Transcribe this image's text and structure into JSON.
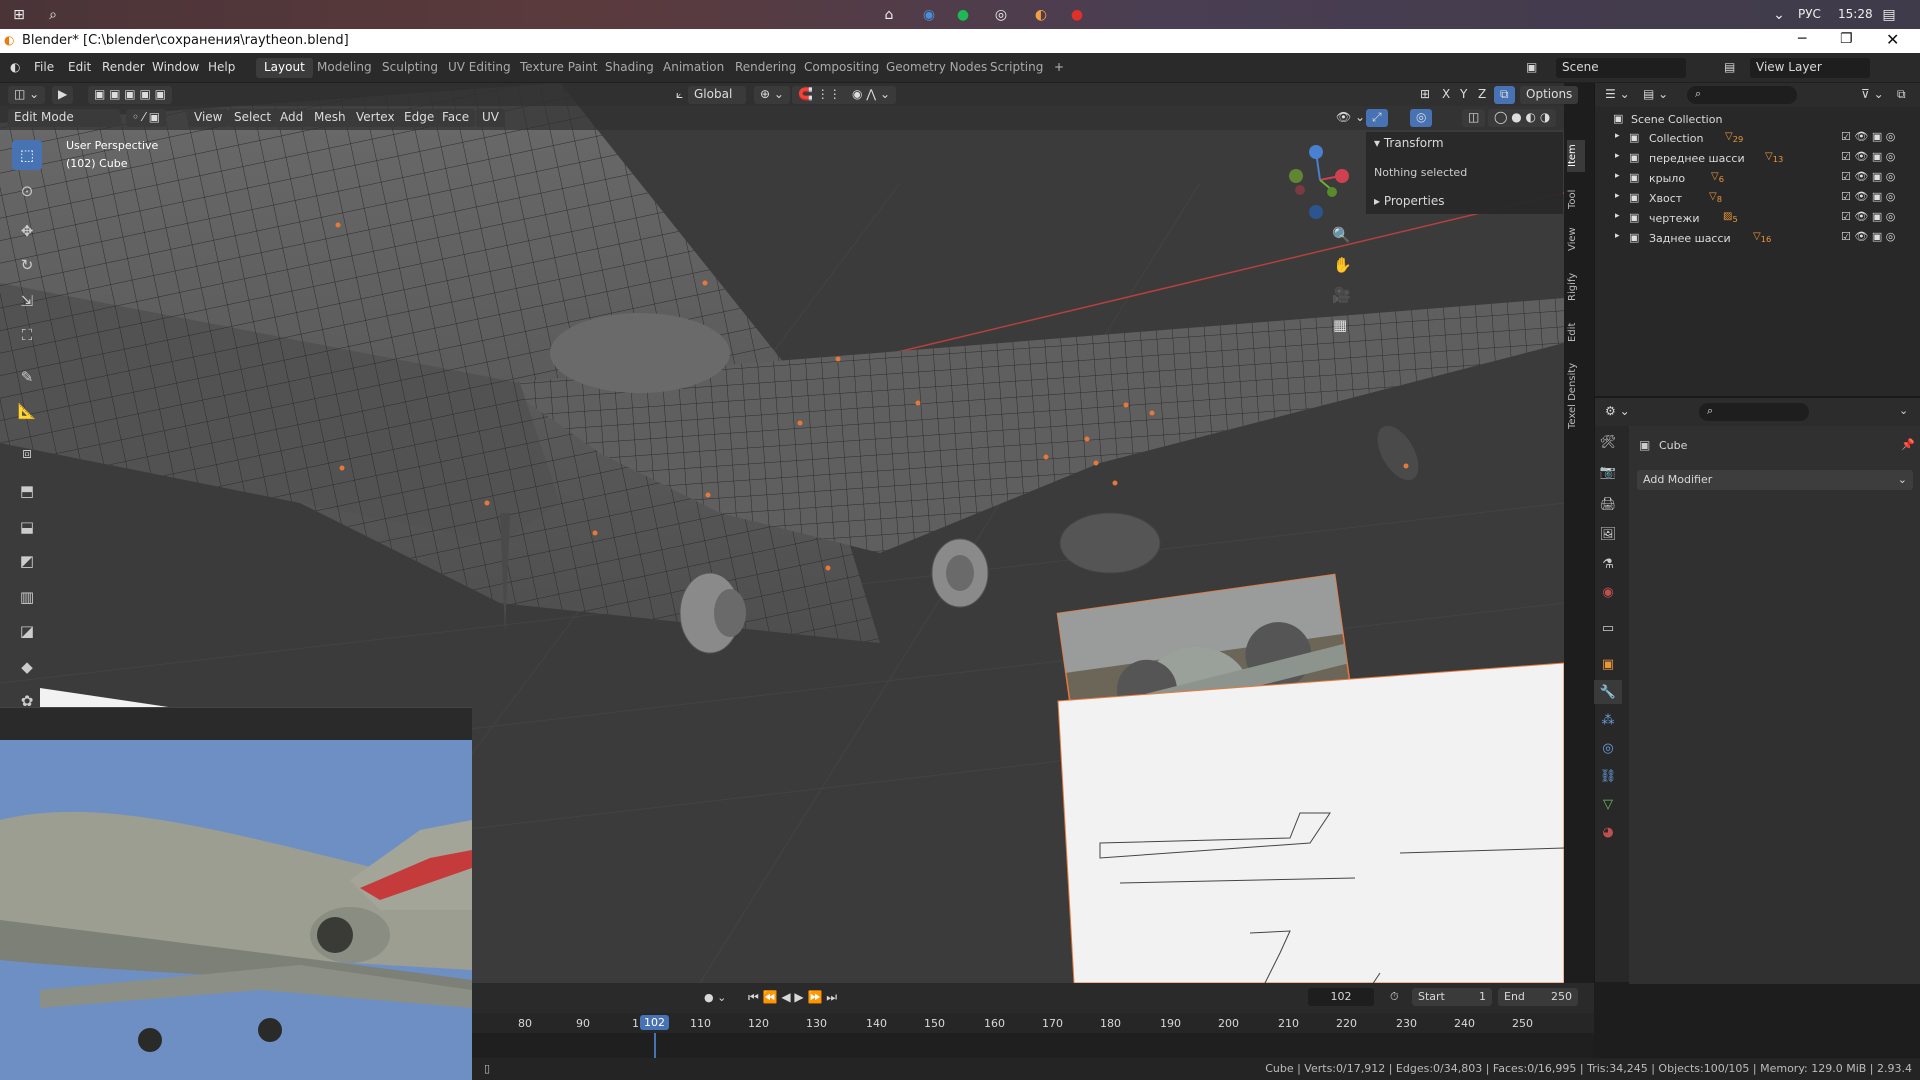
{
  "taskbar": {
    "lang": "РУС",
    "time": "15:28"
  },
  "window": {
    "title": "Blender* [C:\\blender\\сохранения\\raytheon.blend]"
  },
  "menu": {
    "items": [
      "File",
      "Edit",
      "Render",
      "Window",
      "Help"
    ]
  },
  "workspaces": [
    "Layout",
    "Modeling",
    "Sculpting",
    "UV Editing",
    "Texture Paint",
    "Shading",
    "Animation",
    "Rendering",
    "Compositing",
    "Geometry Nodes",
    "Scripting"
  ],
  "active_workspace": "Layout",
  "scene": {
    "label": "Scene",
    "view_layer": "View Layer"
  },
  "viewport": {
    "mode": "Edit Mode",
    "menus": [
      "View",
      "Select",
      "Add",
      "Mesh",
      "Vertex",
      "Edge",
      "Face",
      "UV"
    ],
    "orientation": "Global",
    "options_label": "Options",
    "axes": [
      "X",
      "Y",
      "Z"
    ],
    "perspective": "User Perspective",
    "object": "(102) Cube",
    "npanel": {
      "transform": "Transform",
      "nothing_selected": "Nothing selected",
      "properties": "Properties",
      "tabs": [
        "Item",
        "Tool",
        "View",
        "Rigify",
        "Edit",
        "Texel Density"
      ]
    }
  },
  "outliner": {
    "root": "Scene Collection",
    "items": [
      {
        "name": "Collection",
        "badge": "29"
      },
      {
        "name": "переднее шасси",
        "badge": "13"
      },
      {
        "name": "крыло",
        "badge": "6"
      },
      {
        "name": "Хвост",
        "badge": "8"
      },
      {
        "name": "чертежи",
        "badge": "5"
      },
      {
        "name": "Заднее шасси",
        "badge": "16"
      }
    ]
  },
  "properties": {
    "object": "Cube",
    "add_modifier": "Add Modifier"
  },
  "timeline": {
    "current_frame": "102",
    "start_label": "Start",
    "start": "1",
    "end_label": "End",
    "end": "250",
    "ticks": [
      "80",
      "90",
      "1",
      "102",
      "110",
      "120",
      "130",
      "140",
      "150",
      "160",
      "170",
      "180",
      "190",
      "200",
      "210",
      "220",
      "230",
      "240",
      "250"
    ]
  },
  "status": {
    "text": "Cube | Verts:0/17,912 | Edges:0/34,803 | Faces:0/16,995 | Tris:34,245 | Objects:100/105 | Memory: 129.0 MiB | 2.93.4"
  },
  "colors": {
    "accent": "#4772b3",
    "background": "#3b3b3b"
  }
}
